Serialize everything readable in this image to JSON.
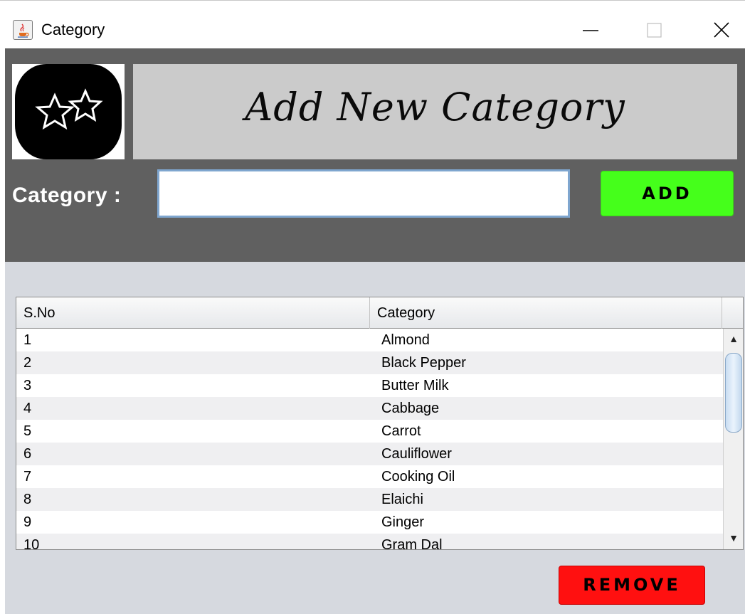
{
  "window": {
    "title": "Category",
    "app_icon": "java-cup-icon",
    "controls": [
      "minimize-icon",
      "maximize-icon",
      "close-icon"
    ]
  },
  "header": {
    "logo_icon": "two-stars-icon",
    "banner_title": "Add New Category",
    "category_label": "Category :",
    "category_input_value": "",
    "add_label": "ADD",
    "add_color": "#45ff1b",
    "background_color": "#606060"
  },
  "table": {
    "columns": [
      "S.No",
      "Category"
    ],
    "rows": [
      [
        "1",
        "Almond"
      ],
      [
        "2",
        "Black Pepper"
      ],
      [
        "3",
        "Butter Milk"
      ],
      [
        "4",
        "Cabbage"
      ],
      [
        "5",
        "Carrot"
      ],
      [
        "6",
        "Cauliflower"
      ],
      [
        "7",
        "Cooking Oil"
      ],
      [
        "8",
        "Elaichi"
      ],
      [
        "9",
        "Ginger"
      ],
      [
        "10",
        "Gram Dal"
      ]
    ]
  },
  "footer": {
    "remove_label": "REMOVE",
    "remove_color": "#ff1010"
  }
}
